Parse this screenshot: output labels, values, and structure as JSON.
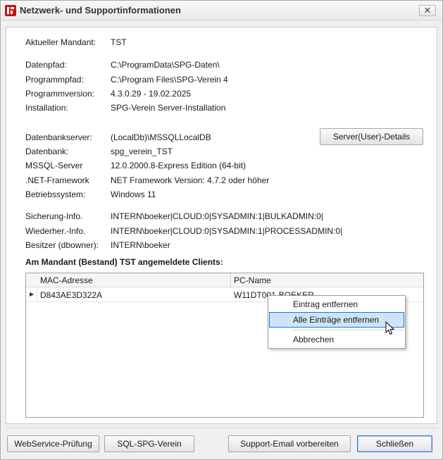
{
  "window": {
    "title": "Netzwerk- und Supportinformationen",
    "close_glyph": "✕",
    "app_icon": "spg-verein-logo-icon"
  },
  "info": {
    "mandant": {
      "label": "Aktueller Mandant:",
      "value": "TST"
    },
    "datenpfad": {
      "label": "Datenpfad:",
      "value": "C:\\ProgramData\\SPG-Daten\\"
    },
    "programmpfad": {
      "label": "Programmpfad:",
      "value": "C:\\Program Files\\SPG-Verein 4"
    },
    "programmversion": {
      "label": "Programmversion:",
      "value": "4.3.0.29 - 19.02.2025"
    },
    "installation": {
      "label": "Installation:",
      "value": "SPG-Verein Server-Installation"
    },
    "datenbankserver": {
      "label": "Datenbankserver:",
      "value": "(LocalDb)\\MSSQLLocalDB"
    },
    "datenbank": {
      "label": "Datenbank:",
      "value": "spg_verein_TST"
    },
    "mssql": {
      "label": "MSSQL-Server",
      "value": "12.0.2000.8-Express Edition (64-bit)"
    },
    "dotnet": {
      "label": ".NET-Framework",
      "value": "NET Framework Version: 4.7.2 oder höher"
    },
    "os": {
      "label": "Betriebssystem:",
      "value": "Windows 11"
    },
    "sicherung": {
      "label": "Sicherung-Info.",
      "value": "INTERN\\boeker|CLOUD:0|SYSADMIN:1|BULKADMIN:0|"
    },
    "wiederher": {
      "label": "Wiederher.-Info.",
      "value": "INTERN\\boeker|CLOUD:0|SYSADMIN:1|PROCESSADMIN:0|"
    },
    "besitzer": {
      "label": "Besitzer (dbowner):",
      "value": "INTERN\\boeker"
    }
  },
  "server_details_button": "Server(User)-Details",
  "clients": {
    "title": "Am Mandant (Bestand) TST angemeldete Clients:",
    "columns": [
      "MAC-Adresse",
      "PC-Name"
    ],
    "rows": [
      {
        "mac": "D843AE3D322A",
        "pc": "W11DT001-BOEKER"
      }
    ],
    "row_indicator": "▶"
  },
  "context_menu": {
    "items": [
      "Eintrag entfernen",
      "Alle Einträge entfernen",
      "Abbrechen"
    ],
    "highlighted_index": 1
  },
  "footer": {
    "webservice": "WebService-Prüfung",
    "sql": "SQL-SPG-Verein",
    "support": "Support-Email vorbereiten",
    "close": "Schließen"
  },
  "colors": {
    "brand": "#c4161c",
    "highlight_bg": "#cfe4fb",
    "highlight_border": "#1e74d6"
  }
}
